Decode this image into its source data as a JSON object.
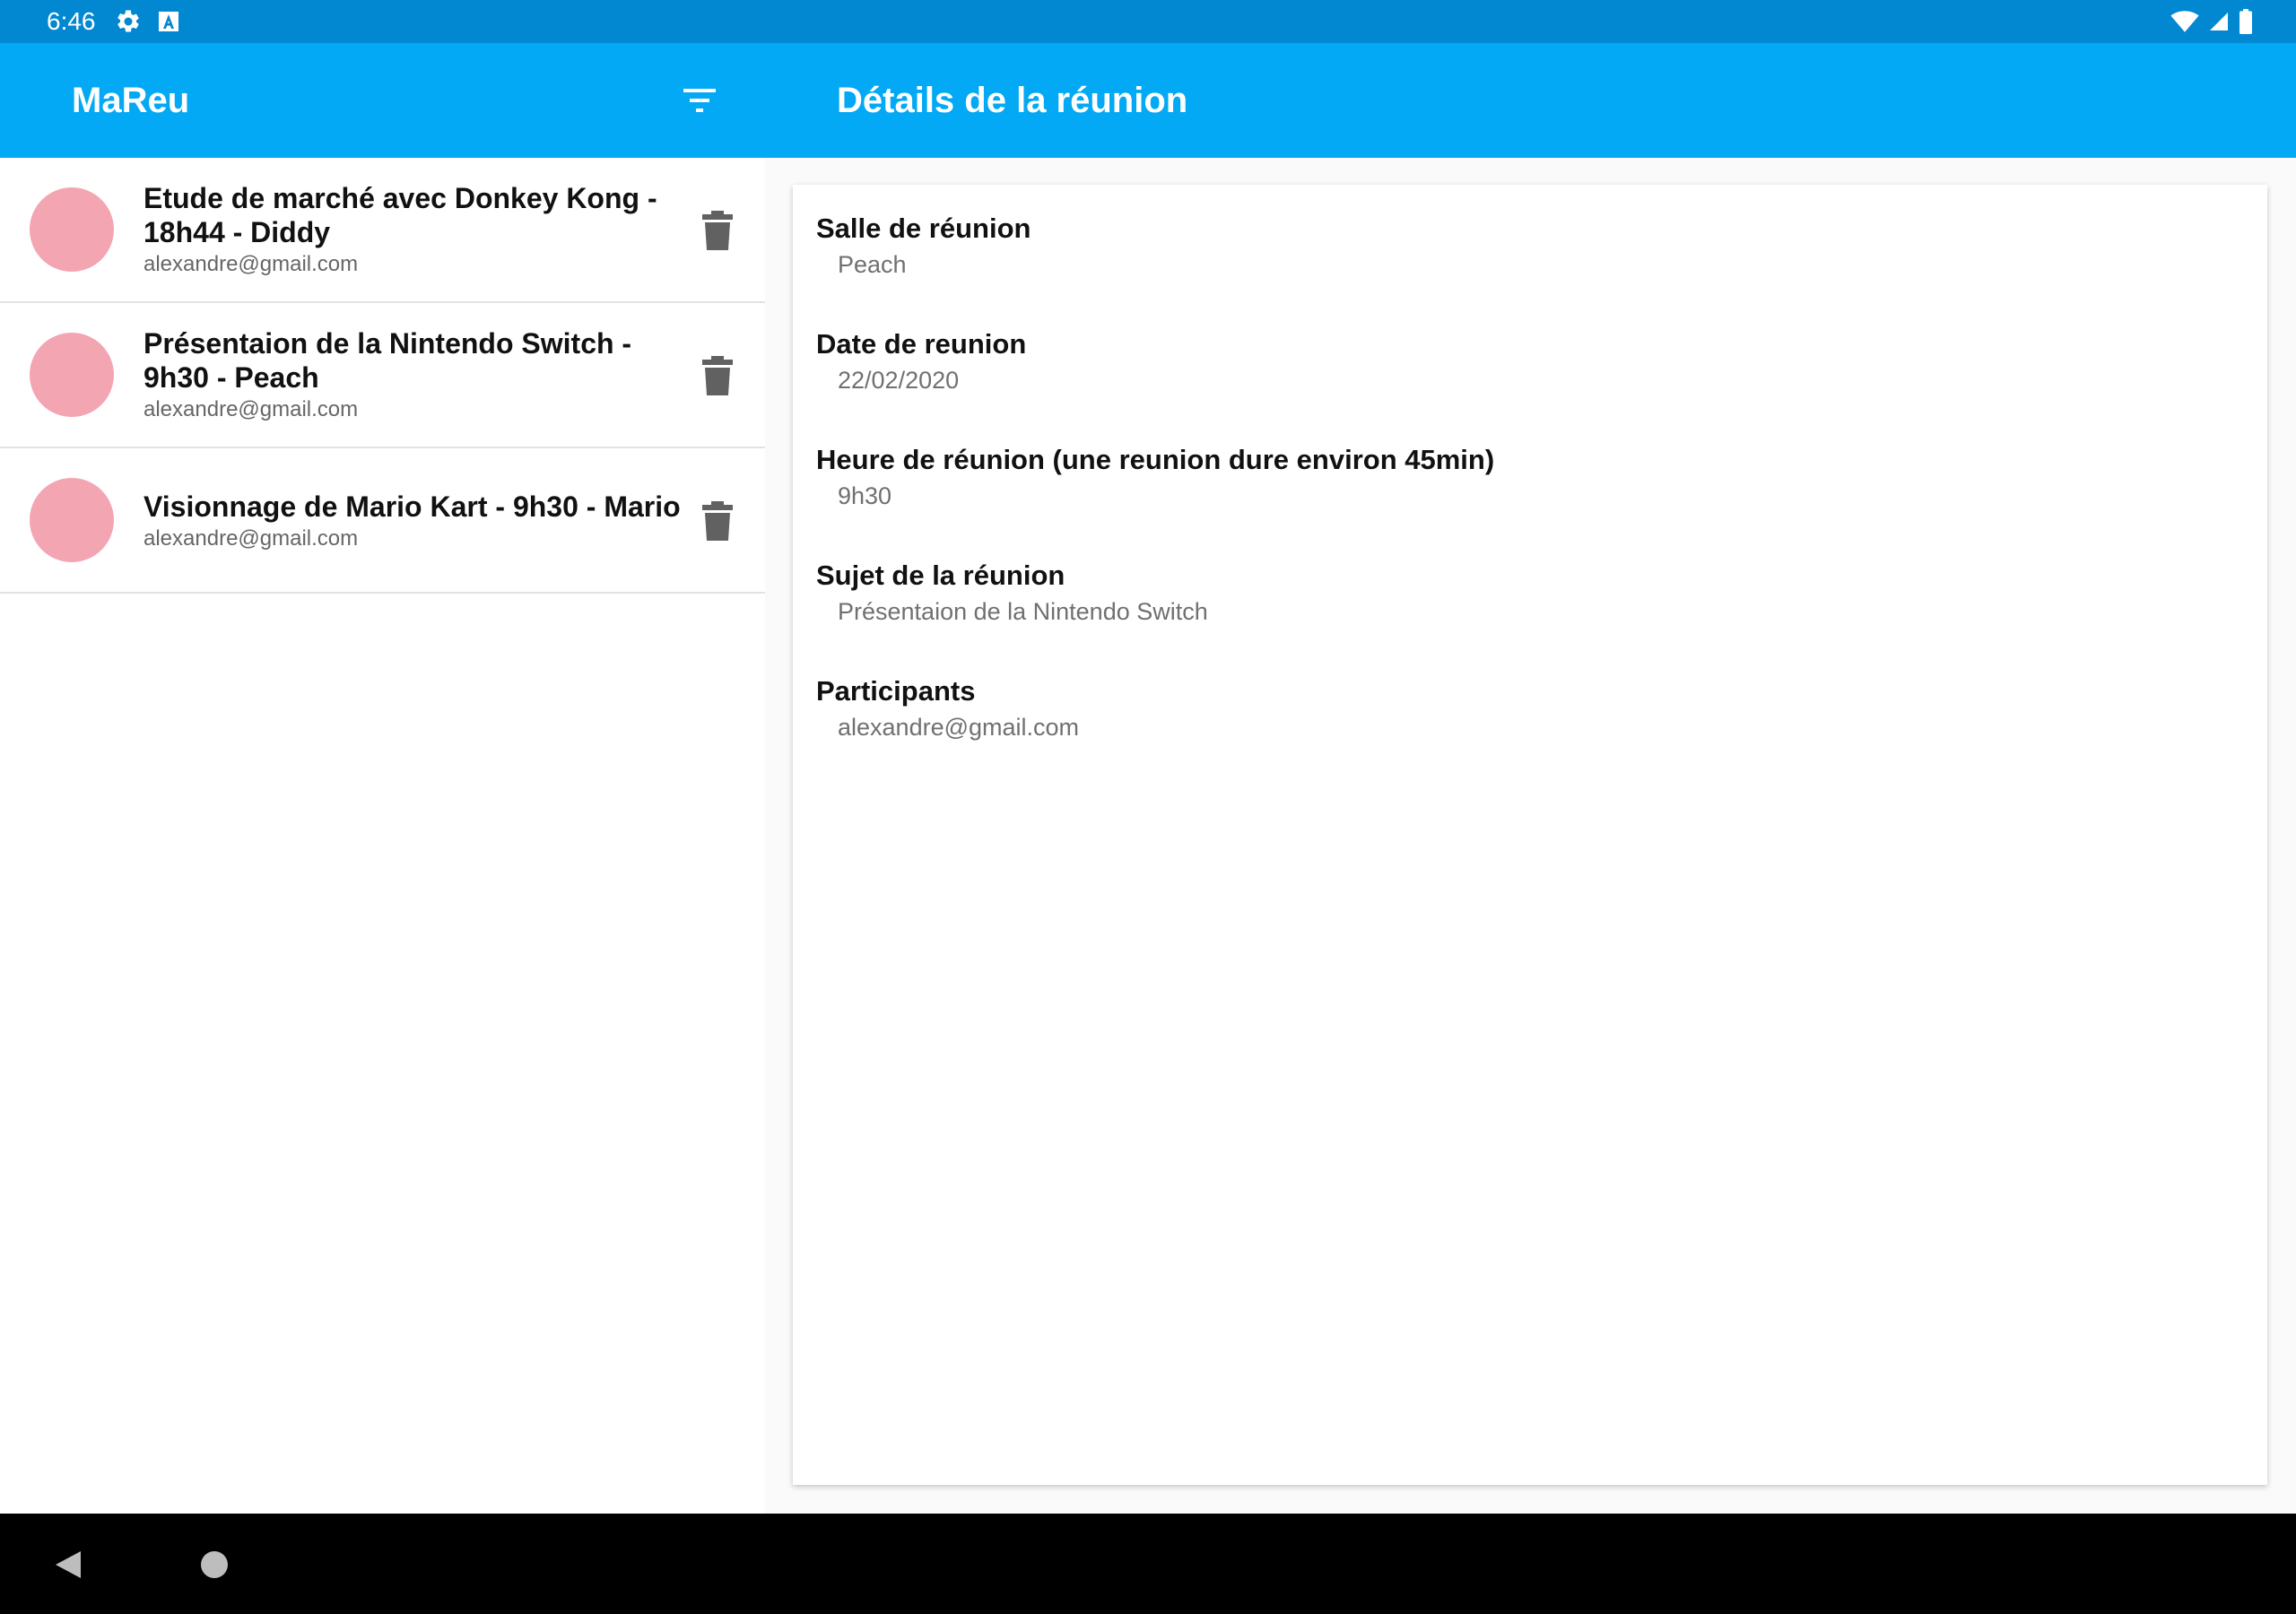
{
  "status_bar": {
    "time": "6:46",
    "left_icons": [
      "settings-gear-icon",
      "accessibility-a-icon"
    ],
    "right_icons": [
      "wifi-icon",
      "signal-icon",
      "battery-icon"
    ]
  },
  "app_bar": {
    "title": "MaReu",
    "filter_icon": "filter-list-icon",
    "color": "#03a9f4"
  },
  "detail_bar": {
    "title": "Détails de la réunion"
  },
  "meetings": [
    {
      "title": "Etude de marché avec Donkey Kong - 18h44 - Diddy",
      "participants": "alexandre@gmail.com",
      "avatar_color": "#f4a5b2"
    },
    {
      "title": "Présentaion de la Nintendo Switch - 9h30 - Peach",
      "participants": "alexandre@gmail.com",
      "avatar_color": "#f4a5b2"
    },
    {
      "title": "Visionnage de Mario Kart - 9h30 - Mario",
      "participants": "alexandre@gmail.com",
      "avatar_color": "#f4a5b2"
    }
  ],
  "details": {
    "room_label": "Salle de réunion",
    "room_value": "Peach",
    "date_label": "Date de reunion",
    "date_value": "22/02/2020",
    "time_label": "Heure de réunion (une reunion dure environ 45min)",
    "time_value": "9h30",
    "subject_label": "Sujet de la réunion",
    "subject_value": "Présentaion de la Nintendo Switch",
    "participants_label": "Participants",
    "participants_value": "alexandre@gmail.com"
  },
  "fab": {
    "icon": "plus-icon",
    "color": "#b71c1c"
  },
  "nav_bar": {
    "back_icon": "back-triangle-icon",
    "home_icon": "home-circle-icon"
  }
}
